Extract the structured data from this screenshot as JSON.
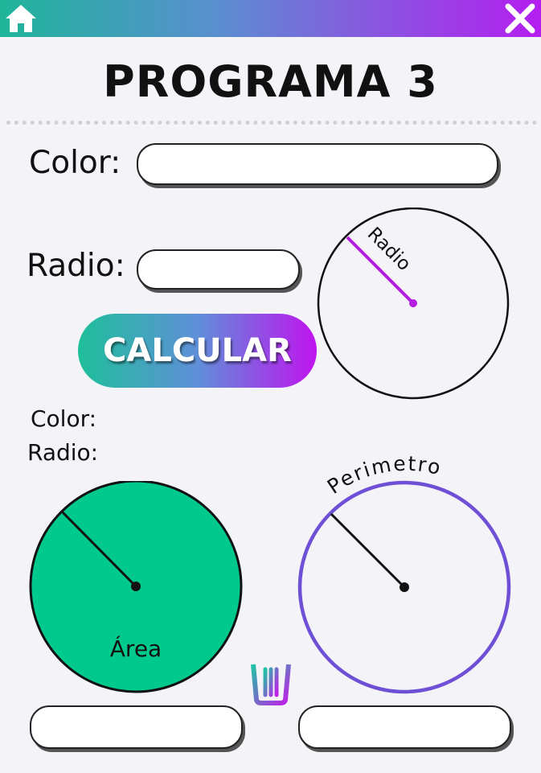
{
  "header": {
    "home_icon": "home-icon",
    "close_icon": "close-icon",
    "gradient_colors": [
      "#1fb59a",
      "#b41ef0"
    ]
  },
  "page": {
    "title": "PROGRAMA 3"
  },
  "form": {
    "color_label": "Color:",
    "color_value": "",
    "radio_label": "Radio:",
    "radio_value": "",
    "calc_label": "CALCULAR"
  },
  "radius_diagram": {
    "label": "Radio",
    "line_color": "#b31ee0"
  },
  "results": {
    "color_label": "Color:",
    "radio_label": "Radio:"
  },
  "area_diagram": {
    "label": "Área",
    "fill": "#00c98d"
  },
  "perimeter_diagram": {
    "label": "Perimetro",
    "stroke": "#6e4fd6"
  },
  "outputs": {
    "area_value": "",
    "perimeter_value": ""
  },
  "trash_icon": "trash-icon"
}
